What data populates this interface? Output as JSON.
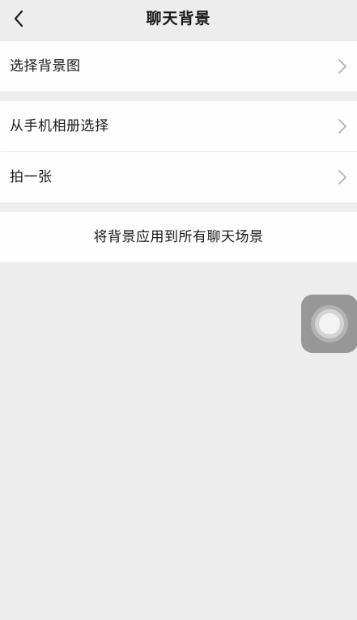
{
  "nav": {
    "title": "聊天背景",
    "back_icon": "chevron-left-icon"
  },
  "menu": {
    "select_background": "选择背景图",
    "from_album": "从手机相册选择",
    "take_photo": "拍一张",
    "apply_all": "将背景应用到所有聊天场景",
    "chevron_icon": "chevron-right-icon"
  },
  "floating": {
    "icon": "assistive-touch-icon"
  },
  "colors": {
    "background": "#ededed",
    "cell": "#fefefe",
    "text": "#1a1a1a",
    "chevron": "#b2b2b2"
  }
}
